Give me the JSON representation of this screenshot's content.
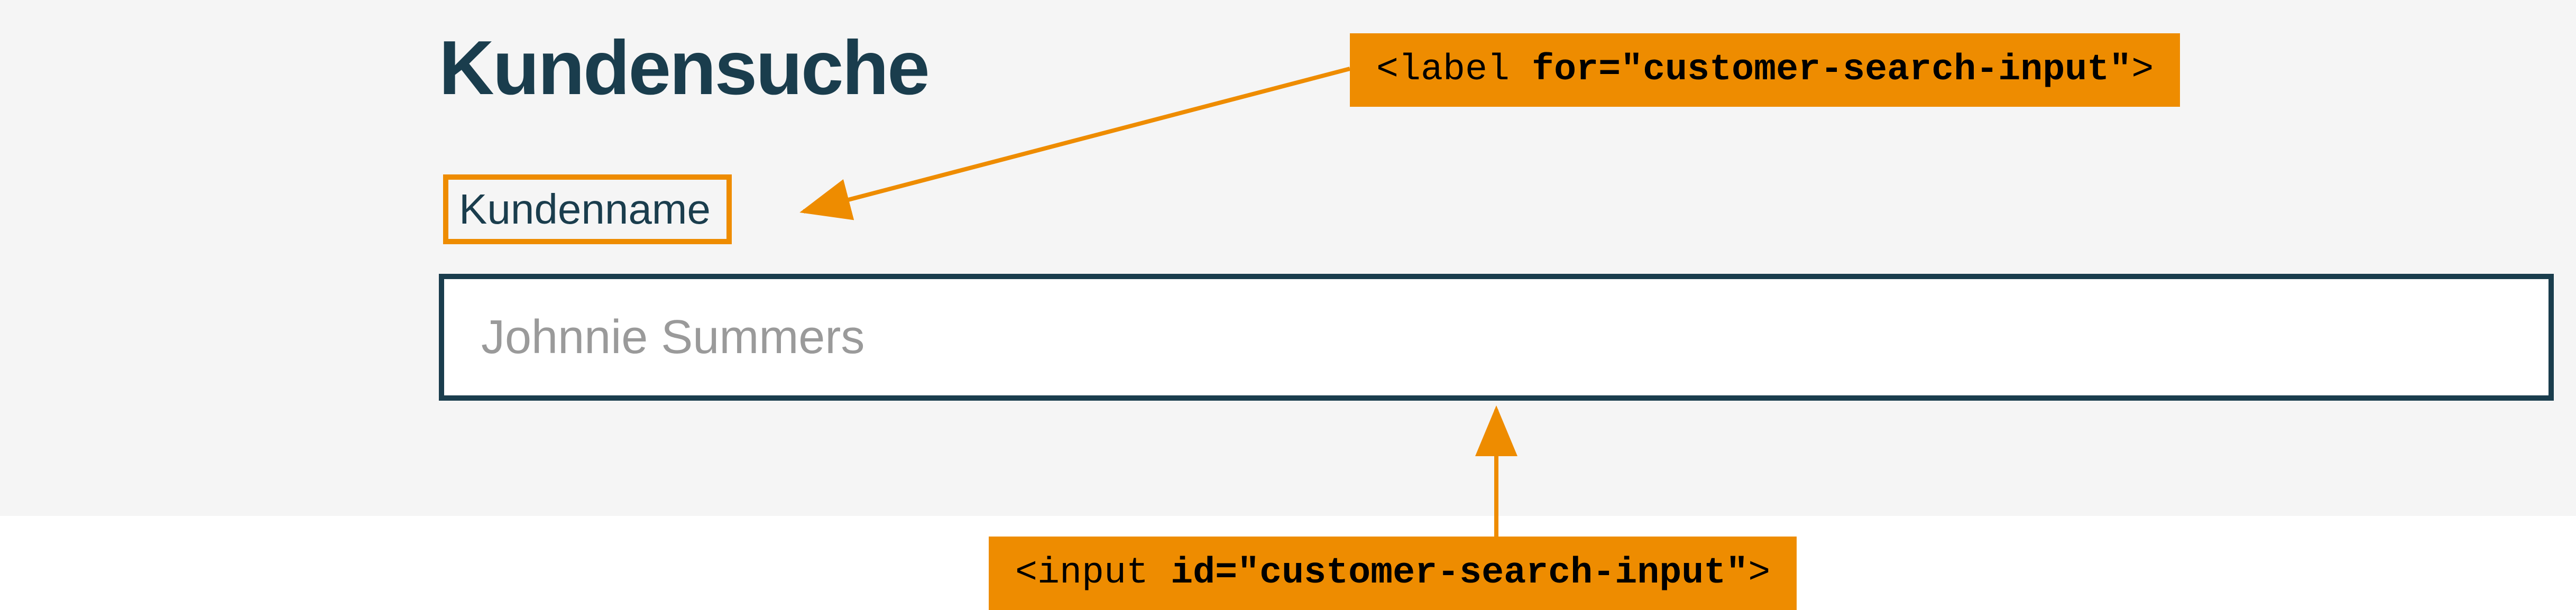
{
  "form": {
    "heading": "Kundensuche",
    "label": "Kundenname",
    "placeholder": "Johnnie Summers"
  },
  "annotations": {
    "labelCallout": {
      "prefix": "<label ",
      "boldPart": "for=\"customer-search-input\"",
      "suffix": ">"
    },
    "inputCallout": {
      "prefix": "<input ",
      "boldPart": "id=\"customer-search-input\"",
      "suffix": ">"
    }
  },
  "colors": {
    "accent": "#ee8c00",
    "darkTeal": "#1a3d4d",
    "placeholderGray": "#9a9a9a",
    "formBg": "#f5f5f5"
  }
}
